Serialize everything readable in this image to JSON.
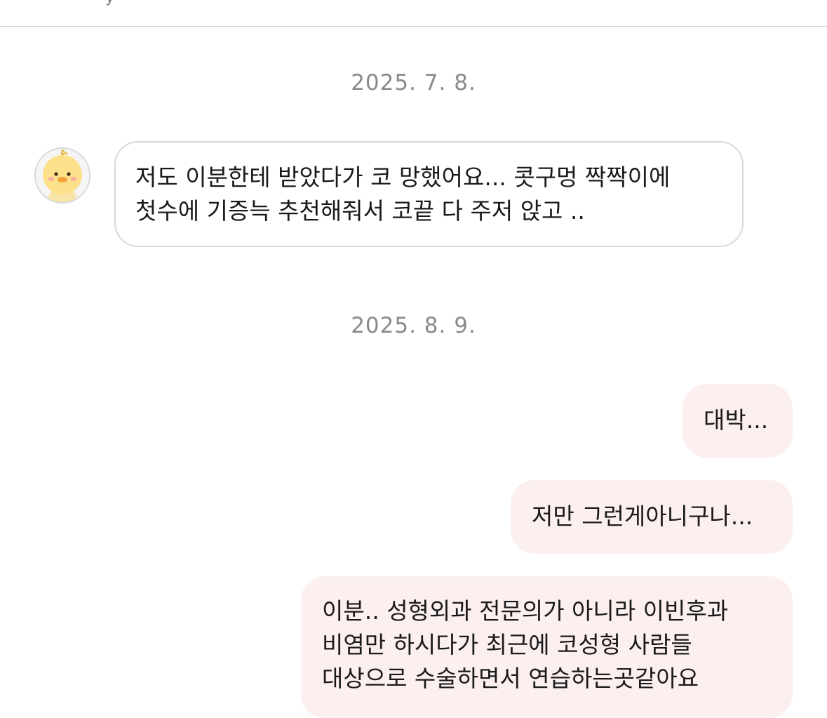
{
  "header": {
    "fragment_glyph": "y"
  },
  "colors": {
    "incoming_bubble_border": "#d9d9d9",
    "outgoing_bubble_bg": "#fcefef",
    "date_text": "#8a8a8a",
    "divider": "#c9c9c9"
  },
  "conversation": {
    "sections": [
      {
        "date": "2025. 7. 8.",
        "messages": [
          {
            "direction": "incoming",
            "avatar_icon": "duck-avatar-icon",
            "text": "저도 이분한테 받았다가 코 망했어요... 콧구멍 짝짝이에\n첫수에 기증늑 추천해줘서 코끝 다 주저 앉고 .."
          }
        ]
      },
      {
        "date": "2025. 8. 9.",
        "messages": [
          {
            "direction": "outgoing",
            "text": "대박..."
          },
          {
            "direction": "outgoing",
            "text": "저만 그런게아니구나..."
          },
          {
            "direction": "outgoing",
            "text": "이분.. 성형외과 전문의가 아니라 이빈후과\n비염만 하시다가 최근에 코성형 사람들\n대상으로 수술하면서 연습하는곳같아요"
          }
        ]
      }
    ]
  }
}
